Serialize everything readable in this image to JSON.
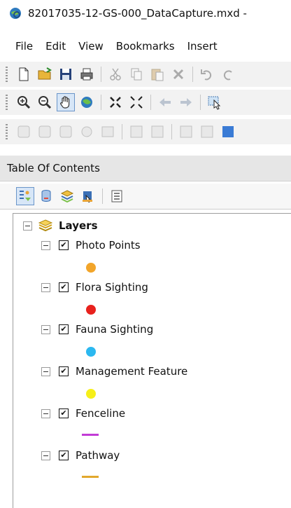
{
  "window": {
    "title": "82017035-12-GS-000_DataCapture.mxd -"
  },
  "menu": [
    "File",
    "Edit",
    "View",
    "Bookmarks",
    "Insert"
  ],
  "toc": {
    "title": "Table Of Contents",
    "group": "Layers",
    "layers": [
      {
        "label": "Photo Points",
        "checked": true,
        "symbol": "point",
        "color": "#f2a52a"
      },
      {
        "label": "Flora Sighting",
        "checked": true,
        "symbol": "point",
        "color": "#e8211d"
      },
      {
        "label": "Fauna Sighting",
        "checked": true,
        "symbol": "point",
        "color": "#2bb8f0"
      },
      {
        "label": "Management Feature",
        "checked": true,
        "symbol": "point",
        "color": "#f6ef19"
      },
      {
        "label": "Fenceline",
        "checked": true,
        "symbol": "line",
        "color": "#c23bd6"
      },
      {
        "label": "Pathway",
        "checked": true,
        "symbol": "line",
        "color": "#e2a82d"
      }
    ]
  },
  "icons": {
    "app": "arcmap-globe-icon",
    "toolbar1": [
      "new-document-icon",
      "open-folder-icon",
      "save-icon",
      "print-icon",
      "cut-icon",
      "copy-icon",
      "paste-icon",
      "delete-icon",
      "undo-icon",
      "redo-icon"
    ],
    "toolbar2": [
      "zoom-in-icon",
      "zoom-out-icon",
      "pan-hand-icon",
      "full-extent-icon",
      "fixed-zoom-in-icon",
      "fixed-zoom-out-icon",
      "back-extent-icon",
      "forward-extent-icon",
      "select-features-icon"
    ],
    "toc_tools": [
      "list-by-drawing-order-icon",
      "list-by-source-icon",
      "list-by-visibility-icon",
      "list-by-selection-icon",
      "options-icon"
    ]
  }
}
